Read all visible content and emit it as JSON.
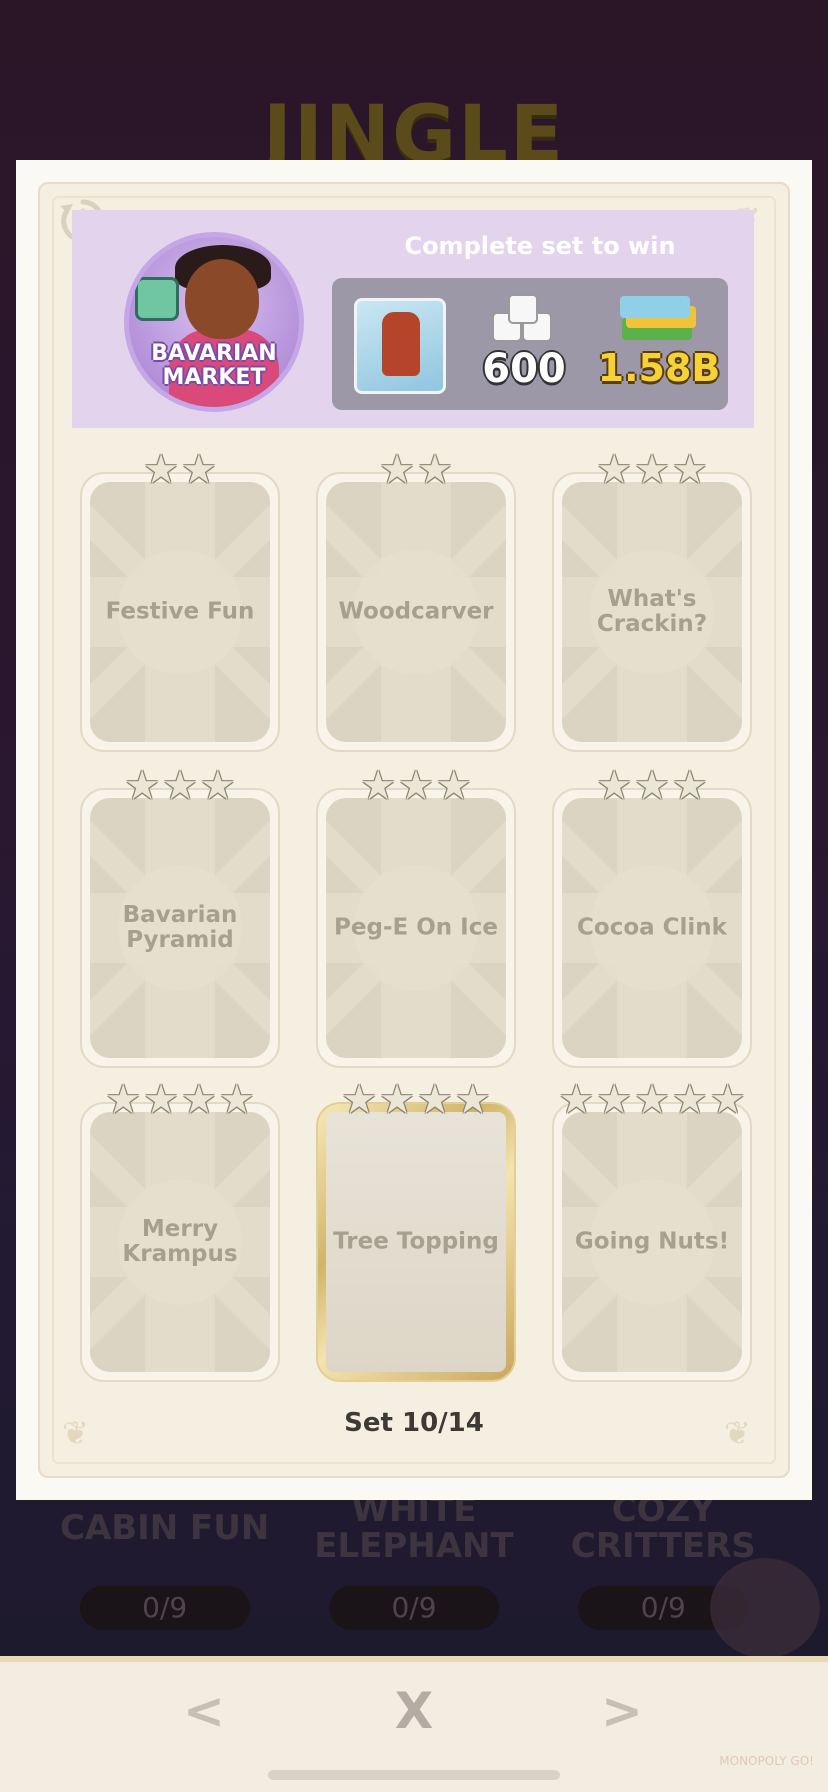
{
  "background": {
    "title": "JINGLE",
    "albums": [
      {
        "name": "CABIN FUN",
        "progress": "0/9"
      },
      {
        "name": "WHITE ELEPHANT",
        "progress": "0/9"
      },
      {
        "name": "COZY CRITTERS",
        "progress": "0/9"
      }
    ]
  },
  "set": {
    "name_line1": "BAVARIAN",
    "name_line2": "MARKET",
    "reward_title": "Complete set to win",
    "rewards": {
      "dice": "600",
      "cash": "1.58B"
    },
    "progress": "Set 10/14"
  },
  "cards": [
    {
      "name": "Festive Fun",
      "stars": 2,
      "golden": false
    },
    {
      "name": "Woodcarver",
      "stars": 2,
      "golden": false
    },
    {
      "name": "What's Crackin?",
      "stars": 3,
      "golden": false
    },
    {
      "name": "Bavarian Pyramid",
      "stars": 3,
      "golden": false
    },
    {
      "name": "Peg-E On Ice",
      "stars": 3,
      "golden": false
    },
    {
      "name": "Cocoa Clink",
      "stars": 3,
      "golden": false
    },
    {
      "name": "Merry Krampus",
      "stars": 4,
      "golden": false
    },
    {
      "name": "Tree Topping",
      "stars": 4,
      "golden": true
    },
    {
      "name": "Going Nuts!",
      "stars": 5,
      "golden": false
    }
  ],
  "nav": {
    "prev": "<",
    "close": "X",
    "next": ">"
  },
  "watermark": "MONOPOLY GO!",
  "colors": {
    "header": "#e3d3ec",
    "badge": "#b490d9",
    "cash_text": "#f5d338",
    "card_text": "#a7a08f"
  },
  "icons": {
    "history": "history-icon",
    "star": "star-icon"
  }
}
